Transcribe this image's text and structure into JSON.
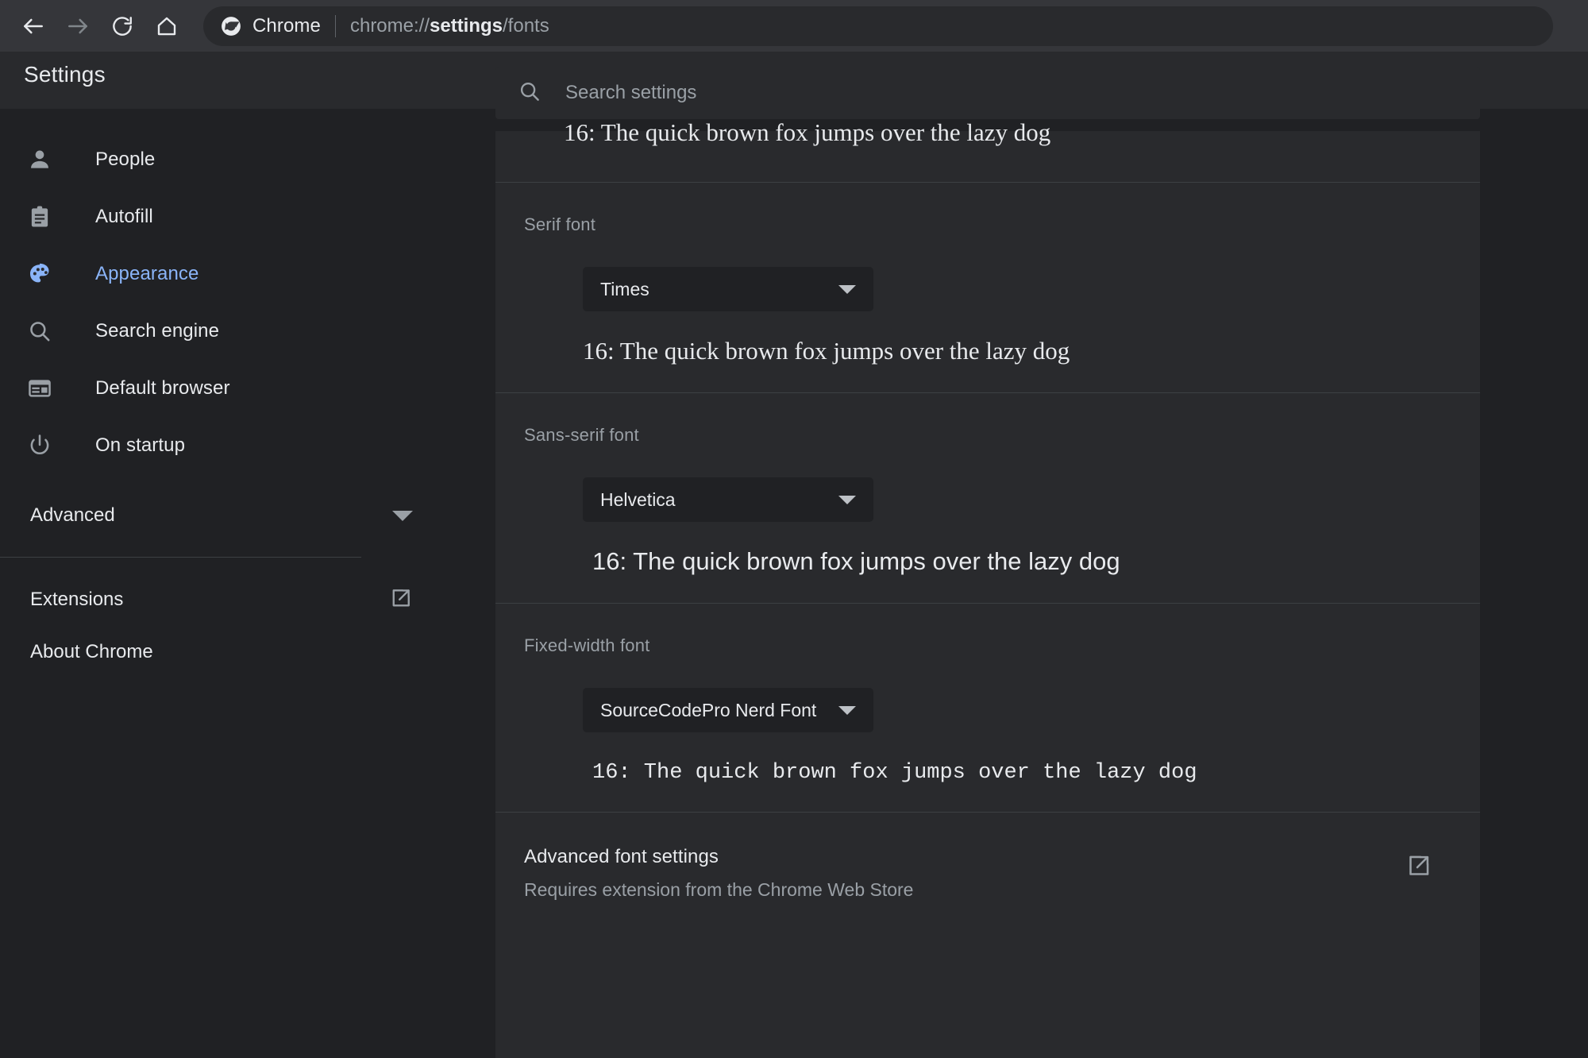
{
  "browser": {
    "back_icon": "arrow-left-icon",
    "forward_icon": "arrow-right-icon",
    "reload_icon": "reload-icon",
    "home_icon": "home-icon",
    "omnibox": {
      "app_chip": "Chrome",
      "url_prefix": "chrome://",
      "url_bold": "settings",
      "url_suffix": "/fonts",
      "full_url": "chrome://settings/fonts"
    }
  },
  "header": {
    "title": "Settings"
  },
  "search": {
    "placeholder": "Search settings",
    "value": "",
    "icon": "search-icon"
  },
  "sidebar": {
    "items": [
      {
        "label": "People",
        "icon": "person-icon",
        "active": false
      },
      {
        "label": "Autofill",
        "icon": "clipboard-icon",
        "active": false
      },
      {
        "label": "Appearance",
        "icon": "palette-icon",
        "active": true
      },
      {
        "label": "Search engine",
        "icon": "search-icon",
        "active": false
      },
      {
        "label": "Default browser",
        "icon": "browser-window-icon",
        "active": false
      },
      {
        "label": "On startup",
        "icon": "power-icon",
        "active": false
      }
    ],
    "advanced": {
      "label": "Advanced",
      "icon": "chevron-down-icon"
    },
    "links": [
      {
        "label": "Extensions",
        "icon": "external-link-icon"
      },
      {
        "label": "About Chrome",
        "icon": ""
      }
    ],
    "active_color": "#8ab4f8"
  },
  "main": {
    "top_partial_sample": "16: The quick brown fox jumps over the lazy dog",
    "sections": [
      {
        "label": "Serif font",
        "selected": "Times",
        "sample": "16: The quick brown fox jumps over the lazy dog",
        "style": "serif"
      },
      {
        "label": "Sans-serif font",
        "selected": "Helvetica",
        "sample": "16: The quick brown fox jumps over the lazy dog",
        "style": "sans"
      },
      {
        "label": "Fixed-width font",
        "selected": "SourceCodePro Nerd Font",
        "sample": "16: The quick brown fox jumps over the lazy dog",
        "style": "mono"
      }
    ],
    "advanced_font_settings": {
      "title": "Advanced font settings",
      "subtitle": "Requires extension from the Chrome Web Store",
      "icon": "external-link-icon"
    }
  },
  "colors": {
    "page_bg": "#202124",
    "card_bg": "#292a2d",
    "toolbar_bg": "#35363a",
    "text_primary": "#e8eaed",
    "text_secondary": "#9aa0a6",
    "divider": "#3c4043",
    "accent": "#8ab4f8"
  }
}
